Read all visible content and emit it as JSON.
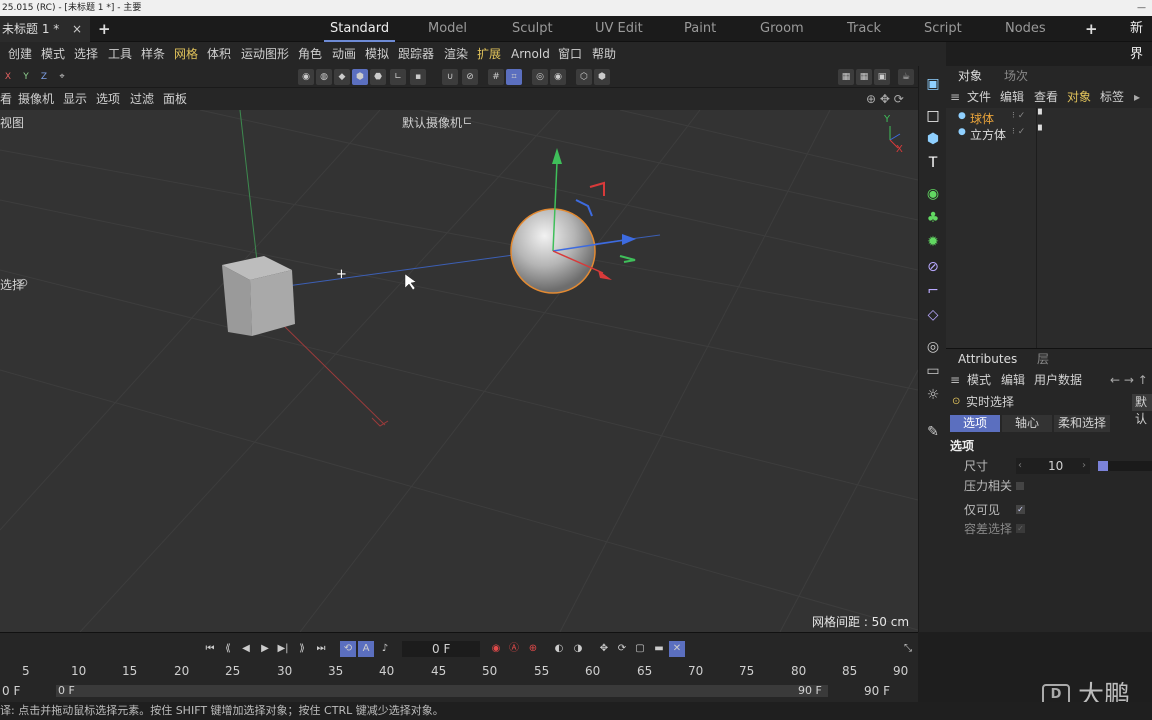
{
  "window": {
    "title": "25.015 (RC) - [未标题 1 *] - 主要"
  },
  "tabs": {
    "doc_tab": "未标题 1 *",
    "close": "×",
    "add": "+",
    "new_label": "新界"
  },
  "layouts": [
    "Standard",
    "Model",
    "Sculpt",
    "UV Edit",
    "Paint",
    "Groom",
    "Track",
    "Script",
    "Nodes"
  ],
  "menubar": [
    "创建",
    "模式",
    "选择",
    "工具",
    "样条",
    "网格",
    "体积",
    "运动图形",
    "角色",
    "动画",
    "模拟",
    "跟踪器",
    "渲染",
    "扩展",
    "Arnold",
    "窗口",
    "帮助"
  ],
  "axis_buttons": [
    "X",
    "Y",
    "Z"
  ],
  "viewmenu": [
    "看",
    "摄像机",
    "显示",
    "选项",
    "过滤",
    "面板"
  ],
  "viewport": {
    "view_name": "视图",
    "camera": "默认摄像机",
    "select_label": "选择",
    "grid_spacing": "网格间距 : 50 cm",
    "axis_x": "X",
    "axis_y": "Y"
  },
  "objects_panel": {
    "tabs": [
      "对象",
      "场次"
    ],
    "menu": [
      "文件",
      "编辑",
      "查看",
      "对象",
      "标签"
    ],
    "items": [
      "球体",
      "立方体"
    ]
  },
  "attributes_panel": {
    "tabs": [
      "Attributes",
      "层"
    ],
    "menu": [
      "模式",
      "编辑",
      "用户数据"
    ],
    "tool": "实时选择",
    "default_btn": "默认",
    "subtabs": [
      "选项",
      "轴心",
      "柔和选择"
    ],
    "section": "选项",
    "size_label": "尺寸",
    "size_value": "10",
    "pressure": "压力相关",
    "visible_only": "仅可见",
    "tolerance": "容差选择"
  },
  "timeline": {
    "current_frame": "0 F",
    "ticks": [
      "5",
      "10",
      "15",
      "20",
      "25",
      "30",
      "35",
      "40",
      "45",
      "50",
      "55",
      "60",
      "65",
      "70",
      "75",
      "80",
      "85",
      "90"
    ],
    "start": "0 F",
    "range_start": "0 F",
    "range_end": "90 F",
    "end": "90 F"
  },
  "status": {
    "text": "译: 点击并拖动鼠标选择元素。按住 SHIFT 键增加选择对象；按住 CTRL 键减少选择对象。"
  },
  "watermark": "大鹏",
  "colors": {
    "accent": "#5b6fbf",
    "selected_object": "#e8a33a",
    "menu_highlight": "#e0c25b"
  }
}
